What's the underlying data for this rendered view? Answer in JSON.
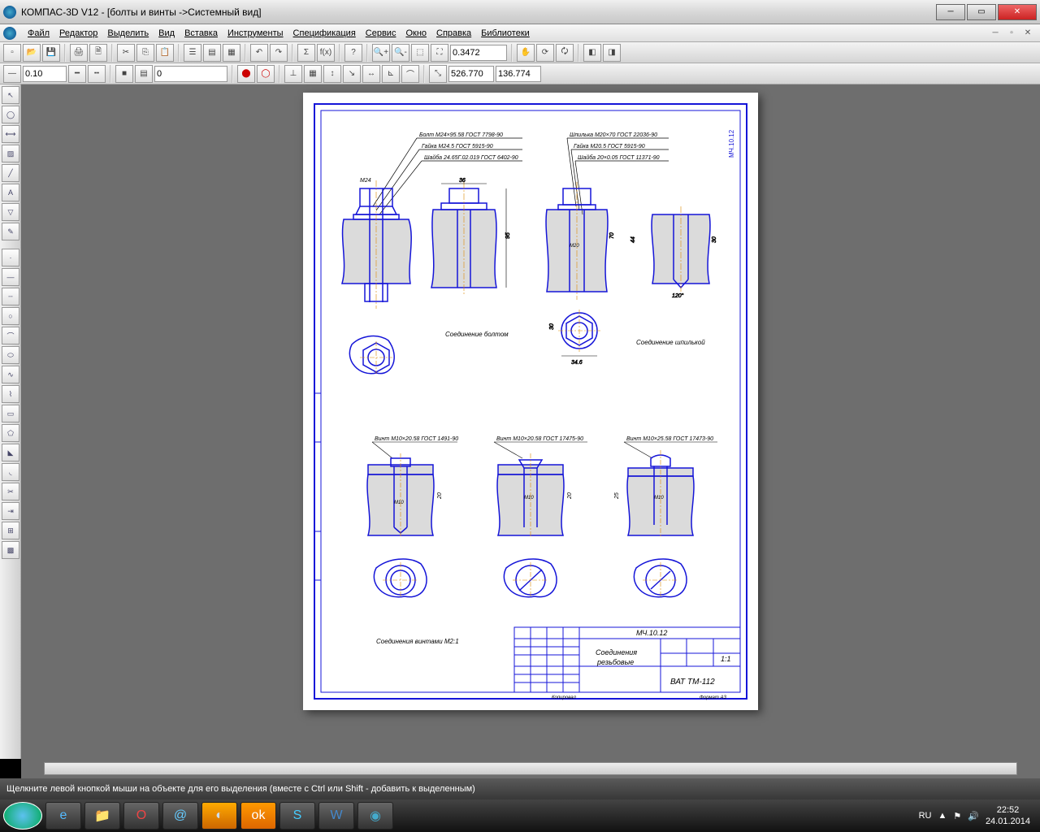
{
  "window": {
    "title": "КОМПАС-3D V12 - [болты и винты ->Системный вид]"
  },
  "menu": [
    "Файл",
    "Редактор",
    "Выделить",
    "Вид",
    "Вставка",
    "Инструменты",
    "Спецификация",
    "Сервис",
    "Окно",
    "Справка",
    "Библиотеки"
  ],
  "toolbar2": {
    "v1": "0.10",
    "v2": "0",
    "zoom": "0.3472",
    "cx": "526.770",
    "cy": "136.774"
  },
  "drawing": {
    "border_code": "МЧ.10.12",
    "call1": [
      "Болт М24×95.58 ГОСТ 7798-90",
      "Гайка М24.5 ГОСТ 5915-90",
      "Шайба 24.65Г.02.019 ГОСТ 6402-90"
    ],
    "call2": [
      "Шпилька М20×70 ГОСТ 22036-90",
      "Гайка М20.5 ГОСТ 5915-90",
      "Шайба 20×0.05 ГОСТ 11371-90"
    ],
    "dim_m24": "М24",
    "dim_36": "36",
    "dim_95": "95",
    "dim_m20": "М20",
    "dim_70": "70",
    "dim_44": "44",
    "dim_30": "30",
    "dim_346": "34.6",
    "dim_30b": "30",
    "dim_120": "120°",
    "lbl_bolt": "Соединение болтом",
    "lbl_stud": "Соединение шпилькой",
    "screw1": "Винт М10×20.58 ГОСТ 1491-90",
    "screw2": "Винт М10×20.58 ГОСТ 17475-90",
    "screw3": "Винт М10×25.58 ГОСТ 17473-90",
    "dim_m10": "М10",
    "dim_20": "20",
    "dim_25": "25",
    "lbl_screws": "Соединения винтами М2:1",
    "title_block": {
      "code": "МЧ.10.12",
      "name1": "Соединения",
      "name2": "резьбовые",
      "scale": "1:1",
      "org": "ВАТ ТМ-112",
      "copied": "Копировал",
      "fmt": "Формат   А3"
    }
  },
  "status": "Щелкните левой кнопкой мыши на объекте для его выделения (вместе с Ctrl или Shift - добавить к выделенным)",
  "tray": {
    "lang": "RU",
    "time": "22:52",
    "date": "24.01.2014"
  }
}
